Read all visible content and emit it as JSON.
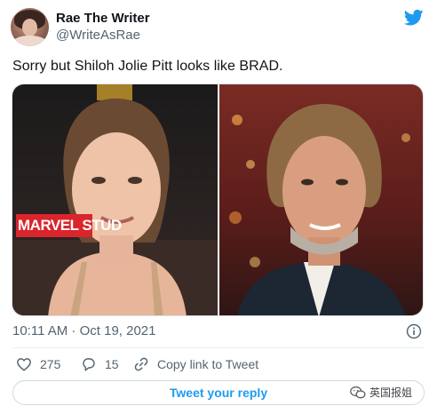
{
  "tweet": {
    "author_name": "Rae The Writer",
    "author_handle": "@WriteAsRae",
    "text": "Sorry but Shiloh Jolie Pitt looks like BRAD.",
    "timestamp": "10:11 AM · Oct 19, 2021",
    "media": {
      "left_photo_sign": "MARVEL STUD"
    }
  },
  "actions": {
    "likes": "275",
    "replies": "15",
    "copy_link_label": "Copy link to Tweet"
  },
  "reply_button_label": "Tweet your reply",
  "watermark_text": "英国报姐",
  "colors": {
    "twitter_blue": "#1d9bf0",
    "text_primary": "#0f1419",
    "text_secondary": "#536471",
    "border": "#cfd9de"
  },
  "icons": {
    "brand": "twitter-bird-icon",
    "info": "info-icon",
    "like": "heart-icon",
    "reply": "reply-bubble-icon",
    "link": "link-icon",
    "watermark": "wechat-icon"
  }
}
